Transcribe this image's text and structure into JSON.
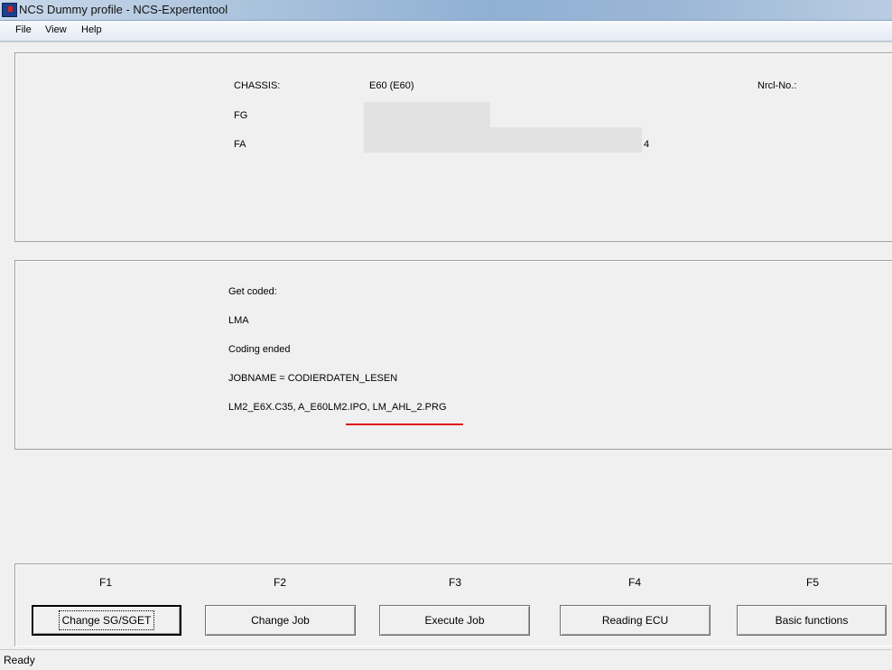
{
  "window": {
    "title": "NCS Dummy profile - NCS-Expertentool",
    "icon": "ncs-app-icon"
  },
  "menu": {
    "items": [
      "File",
      "View",
      "Help"
    ]
  },
  "vehicle_info": {
    "chassis_label": "CHASSIS:",
    "chassis_value": "E60 (E60)",
    "nrcl_label": "Nrcl-No.:",
    "fg_label": "FG",
    "fa_label": "FA",
    "fa_value_suffix": "4"
  },
  "log": {
    "lines": [
      "Get coded:",
      "LMA",
      "Coding ended",
      "JOBNAME = CODIERDATEN_LESEN",
      "LM2_E6X.C35, A_E60LM2.IPO, LM_AHL_2.PRG"
    ],
    "highlight_color": "#e01010"
  },
  "function_keys": [
    {
      "key": "F1",
      "label": "Change SG/SGET"
    },
    {
      "key": "F2",
      "label": "Change Job"
    },
    {
      "key": "F3",
      "label": "Execute Job"
    },
    {
      "key": "F4",
      "label": "Reading ECU"
    },
    {
      "key": "F5",
      "label": "Basic functions"
    }
  ],
  "status": {
    "text": "Ready"
  }
}
